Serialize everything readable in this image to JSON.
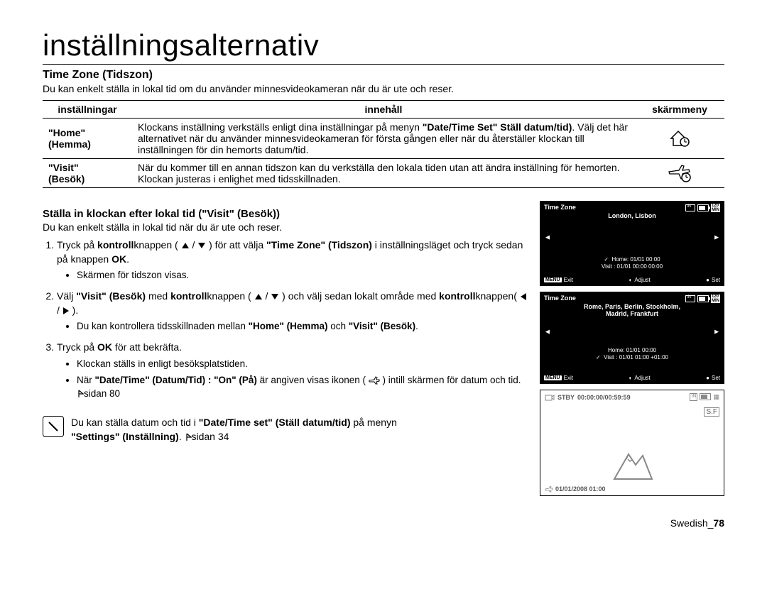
{
  "page_title": "inställningsalternativ",
  "section_heading": "Time Zone (Tidszon)",
  "intro": "Du kan enkelt ställa in lokal tid om du använder minnesvideokameran när du är ute och reser.",
  "table": {
    "headers": {
      "col1": "inställningar",
      "col2": "innehåll",
      "col3": "skärmmeny"
    },
    "rows": [
      {
        "setting_line1": "\"Home\"",
        "setting_line2": "(Hemma)",
        "content_pre": "Klockans inställning verkställs enligt dina inställningar på menyn ",
        "content_b": "\"Date/Time Set\" Ställ datum/tid)",
        "content_post": ". Välj det här alternativet när du använder minnesvideokameran för första gången eller när du återställer klockan till inställningen för din hemorts datum/tid."
      },
      {
        "setting_line1": "\"Visit\"",
        "setting_line2": "(Besök)",
        "content": "När du kommer till en annan tidszon kan du verkställa den lokala tiden utan att ändra inställning för hemorten. Klockan justeras i enlighet med tidsskillnaden."
      }
    ]
  },
  "sub_heading": "Ställa in klockan efter lokal tid (\"Visit\" (Besök))",
  "sub_intro": "Du kan enkelt ställa in lokal tid när du är ute och reser.",
  "steps": [
    {
      "pre": "Tryck på ",
      "b1": "kontroll",
      "mid1": "knappen ( ",
      "mid2": " / ",
      "mid3": " ) för att välja ",
      "b2": "\"Time Zone\" (Tidszon)",
      "post": " i inställningsläget och tryck sedan på knappen ",
      "b3": "OK",
      "post2": ".",
      "bullets": [
        "Skärmen för tidszon visas."
      ]
    },
    {
      "pre": "Välj ",
      "b1": "\"Visit\" (Besök)",
      "mid1": " med ",
      "b1b": "kontroll",
      "mid1b": "knappen ( ",
      "mid2": " / ",
      "mid3": " ) och välj sedan lokalt område med ",
      "b1c": "kontroll",
      "mid3b": "knappen( ",
      "mid4": " / ",
      "mid5": " ).",
      "bullets_rich": {
        "pre": "Du kan kontrollera tidsskillnaden mellan ",
        "b1": "\"Home\" (Hemma)",
        "mid": " och ",
        "b2": "\"Visit\" (Besök)",
        "post": "."
      }
    },
    {
      "pre": "Tryck på ",
      "b1": "OK",
      "post": " för att bekräfta.",
      "bullets": [
        "Klockan ställs in enligt besöksplatstiden."
      ],
      "bullet2": {
        "pre": "När ",
        "b1": "\"Date/Time\" (Datum/Tid) : \"On\" (På)",
        "mid": " är angiven visas ikonen ( ",
        "post": " ) intill skärmen för datum och tid. ",
        "ref": "sidan 80"
      }
    }
  ],
  "note": {
    "pre": "Du kan ställa datum och tid i ",
    "b1": "\"Date/Time set\" (Ställ datum/tid)",
    "mid": " på menyn ",
    "b2": "\"Settings\" (Inställning)",
    "post": ". ",
    "ref": "sidan 34"
  },
  "lcd1": {
    "title": "Time Zone",
    "city": "London, Lisbon",
    "home": "Home: 01/01 00:00",
    "visit": "Visit  : 01/01 00:00 00:00",
    "menu": "MENU",
    "exit": "Exit",
    "adjust": "Adjust",
    "set": "Set",
    "min": "120",
    "min_label": "MIN"
  },
  "lcd2": {
    "title": "Time Zone",
    "city1": "Rome, Paris, Berlin, Stockholm,",
    "city2": "Madrid, Frankfurt",
    "home": "Home: 01/01 00:00",
    "visit": "Visit  : 01/01 01:00 +01:00",
    "menu": "MENU",
    "exit": "Exit",
    "adjust": "Adjust",
    "set": "Set",
    "min": "120",
    "min_label": "MIN"
  },
  "stby": {
    "label": "STBY",
    "time": "00:00:00/00:59:59",
    "sf": "S.F",
    "date": "01/01/2008 01:00"
  },
  "footer": {
    "lang": "Swedish_",
    "page": "78"
  }
}
